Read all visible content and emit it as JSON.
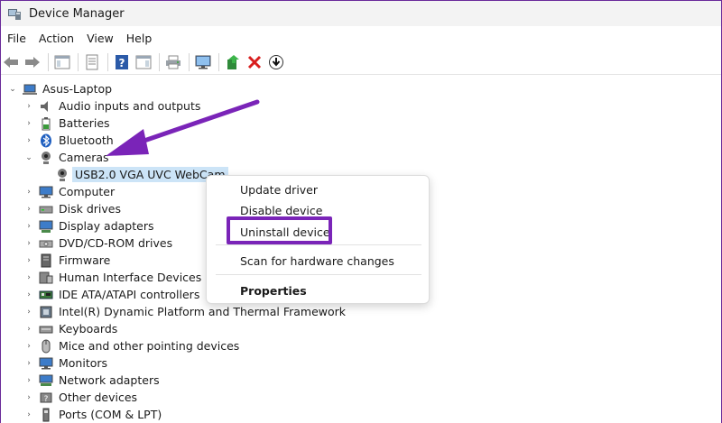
{
  "window": {
    "title": "Device Manager"
  },
  "menu": [
    "File",
    "Action",
    "View",
    "Help"
  ],
  "toolbar": {
    "icons": [
      "back-arrow-icon",
      "forward-arrow-icon",
      "console-tree-icon",
      "properties-sheet-icon",
      "help-icon",
      "action-pane-icon",
      "print-icon",
      "monitor-scan-icon",
      "update-driver-icon",
      "uninstall-x-icon",
      "download-arrow-icon"
    ]
  },
  "tree": {
    "root": "Asus-Laptop",
    "items": [
      {
        "label": "Audio inputs and outputs",
        "icon": "speaker-icon",
        "expanded": false
      },
      {
        "label": "Batteries",
        "icon": "battery-icon",
        "expanded": false
      },
      {
        "label": "Bluetooth",
        "icon": "bluetooth-icon",
        "expanded": false
      },
      {
        "label": "Cameras",
        "icon": "camera-icon",
        "expanded": true
      },
      {
        "label": "Computer",
        "icon": "computer-icon",
        "expanded": false
      },
      {
        "label": "Disk drives",
        "icon": "disk-drive-icon",
        "expanded": false
      },
      {
        "label": "Display adapters",
        "icon": "display-adapter-icon",
        "expanded": false
      },
      {
        "label": "DVD/CD-ROM drives",
        "icon": "dvd-drive-icon",
        "expanded": false
      },
      {
        "label": "Firmware",
        "icon": "firmware-icon",
        "expanded": false
      },
      {
        "label": "Human Interface Devices",
        "icon": "hid-icon",
        "expanded": false
      },
      {
        "label": "IDE ATA/ATAPI controllers",
        "icon": "ide-controller-icon",
        "expanded": false
      },
      {
        "label": "Intel(R) Dynamic Platform and Thermal Framework",
        "icon": "intel-framework-icon",
        "expanded": false
      },
      {
        "label": "Keyboards",
        "icon": "keyboard-icon",
        "expanded": false
      },
      {
        "label": "Mice and other pointing devices",
        "icon": "mouse-icon",
        "expanded": false
      },
      {
        "label": "Monitors",
        "icon": "monitor-icon",
        "expanded": false
      },
      {
        "label": "Network adapters",
        "icon": "network-adapter-icon",
        "expanded": false
      },
      {
        "label": "Other devices",
        "icon": "other-devices-icon",
        "expanded": false
      },
      {
        "label": "Ports (COM & LPT)",
        "icon": "port-icon",
        "expanded": false
      }
    ],
    "camera_child": "USB2.0 VGA UVC WebCam"
  },
  "context_menu": {
    "update": "Update driver",
    "disable": "Disable device",
    "uninstall": "Uninstall device",
    "scan": "Scan for hardware changes",
    "properties": "Properties"
  },
  "colors": {
    "highlight": "#7a24b8",
    "selection": "#cce4f7"
  }
}
